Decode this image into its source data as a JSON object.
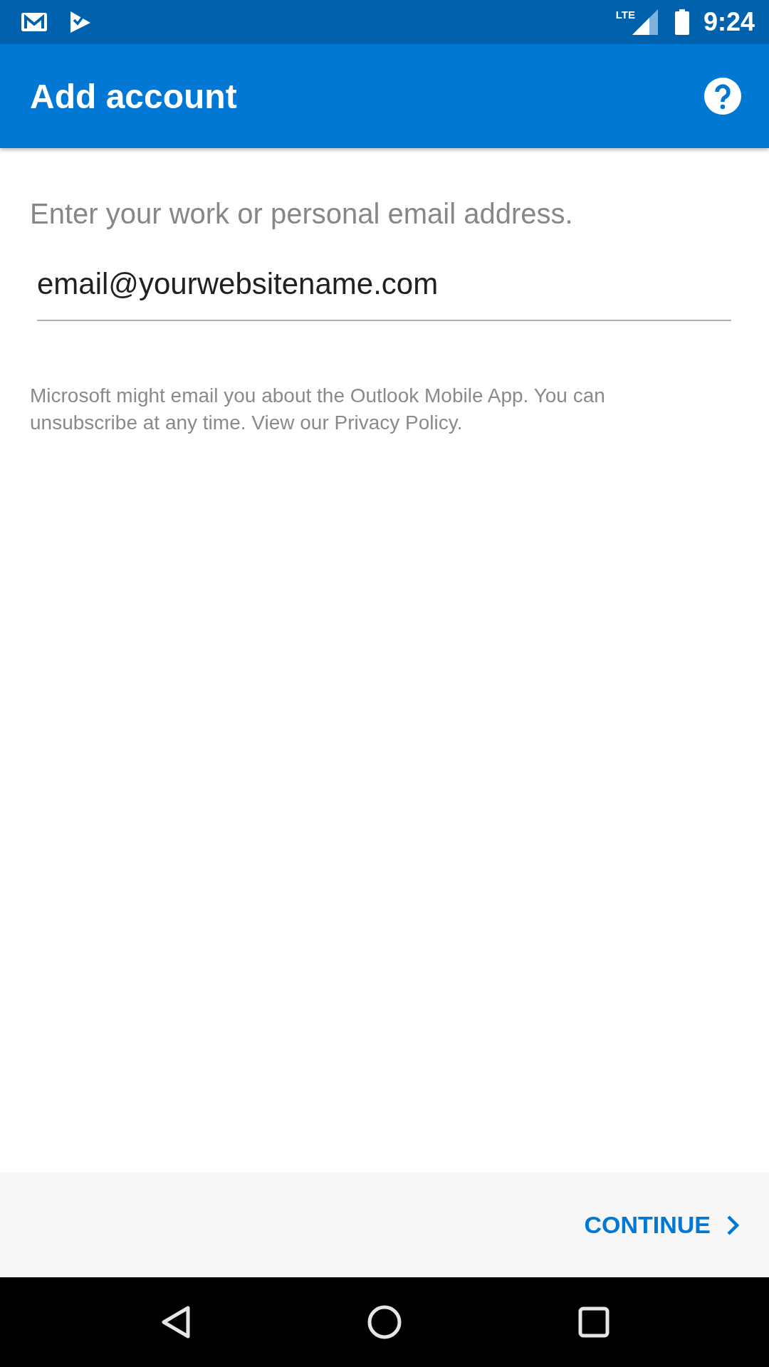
{
  "status_bar": {
    "network": "LTE",
    "time": "9:24"
  },
  "app_bar": {
    "title": "Add account"
  },
  "prompt": "Enter your work or personal email address.",
  "email_field": {
    "value": "email@yourwebsitename.com"
  },
  "disclaimer": "Microsoft might email you about the Outlook Mobile App. You can unsubscribe at any time. View our Privacy Policy.",
  "continue_button": {
    "label": "CONTINUE"
  }
}
